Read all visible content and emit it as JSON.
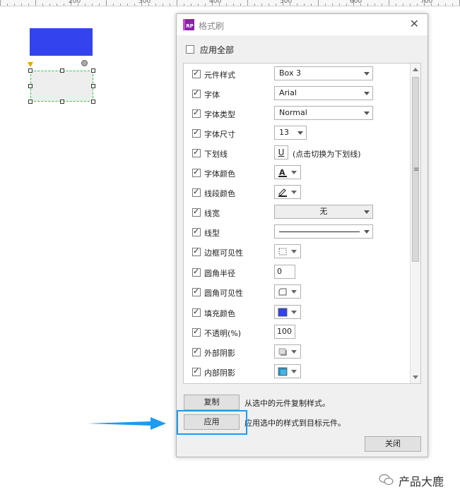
{
  "ruler": {
    "labels": [
      "200",
      "300",
      "400",
      "500",
      "600",
      "700"
    ]
  },
  "dialog": {
    "logo_text": "RP",
    "title": "格式刷",
    "close_glyph": "✕",
    "apply_all": {
      "label": "应用全部",
      "checked": false
    },
    "properties": [
      {
        "label": "元件样式",
        "checked": true,
        "control": "select",
        "value": "Box 3"
      },
      {
        "label": "字体",
        "checked": true,
        "control": "select",
        "value": "Arial"
      },
      {
        "label": "字体类型",
        "checked": true,
        "control": "select",
        "value": "Normal"
      },
      {
        "label": "字体尺寸",
        "checked": true,
        "control": "select-small",
        "value": "13"
      },
      {
        "label": "下划线",
        "checked": true,
        "control": "underline",
        "value": "U",
        "hint": "(点击切换为下划线)"
      },
      {
        "label": "字体颜色",
        "checked": true,
        "control": "icon",
        "icon": "font-color-icon"
      },
      {
        "label": "线段颜色",
        "checked": true,
        "control": "icon",
        "icon": "line-color-icon"
      },
      {
        "label": "线宽",
        "checked": true,
        "control": "select-center",
        "value": "无"
      },
      {
        "label": "线型",
        "checked": true,
        "control": "line-style"
      },
      {
        "label": "边框可见性",
        "checked": true,
        "control": "icon",
        "icon": "border-visibility-icon"
      },
      {
        "label": "圆角半径",
        "checked": true,
        "control": "input",
        "value": "0"
      },
      {
        "label": "圆角可见性",
        "checked": true,
        "control": "icon",
        "icon": "corner-visibility-icon"
      },
      {
        "label": "填充颜色",
        "checked": true,
        "control": "icon",
        "icon": "fill-color-icon",
        "color": "#3344ee"
      },
      {
        "label": "不透明(%)",
        "checked": true,
        "control": "input",
        "value": "100"
      },
      {
        "label": "外部阴影",
        "checked": true,
        "control": "icon",
        "icon": "outer-shadow-icon"
      },
      {
        "label": "内部阴影",
        "checked": true,
        "control": "icon",
        "icon": "inner-shadow-icon"
      }
    ],
    "copy_button": "复制",
    "copy_desc": "从选中的元件复制样式。",
    "apply_button": "应用",
    "apply_desc": "应用选中的样式到目标元件。",
    "close_button": "关闭"
  },
  "canvas": {
    "shape_color": "#3344ee",
    "selection_color": "#22cc44"
  },
  "annotation": {
    "highlight_color": "#1e9bef"
  },
  "watermark": {
    "text": "产品大鹿"
  }
}
